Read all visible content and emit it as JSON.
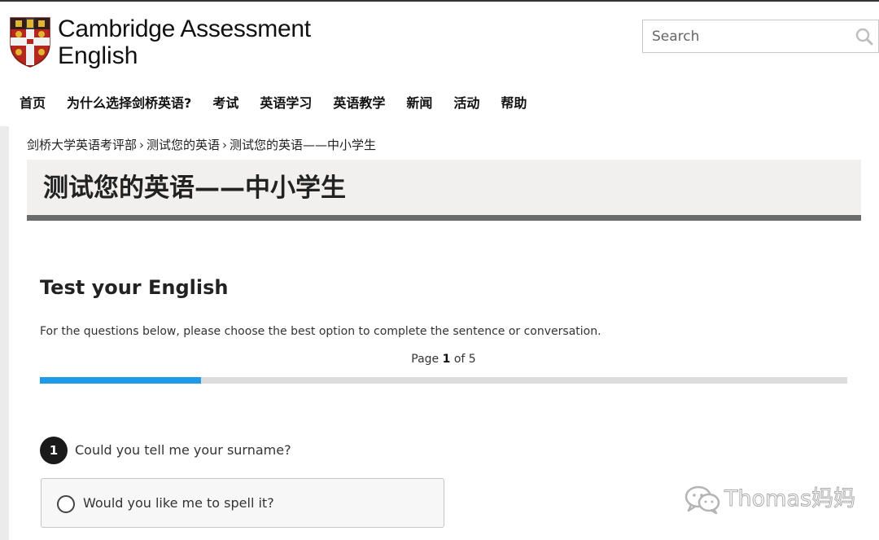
{
  "header": {
    "logo_line1": "Cambridge Assessment",
    "logo_line2": "English",
    "search_placeholder": "Search"
  },
  "nav": {
    "items": [
      "首页",
      "为什么选择剑桥英语?",
      "考试",
      "英语学习",
      "英语教学",
      "新闻",
      "活动",
      "帮助"
    ]
  },
  "breadcrumb": {
    "items": [
      "剑桥大学英语考评部",
      "测试您的英语",
      "测试您的英语——中小学生"
    ],
    "separator": "›"
  },
  "page_title": "测试您的英语——中小学生",
  "test": {
    "heading": "Test your English",
    "instructions": "For the questions below, please choose the best option to complete the sentence or conversation.",
    "page_prefix": "Page",
    "page_current": "1",
    "page_of": "of",
    "page_total": "5",
    "progress_fraction": 0.2
  },
  "question": {
    "number": "1",
    "text": "Could you tell me your surname?",
    "options": [
      "Would you like me to spell it?"
    ]
  },
  "watermark": {
    "text": "Thomas妈妈"
  },
  "colors": {
    "progress": "#1e9be6",
    "title_underline": "#6b6b6b",
    "banner_bg": "#f1f0ee"
  }
}
